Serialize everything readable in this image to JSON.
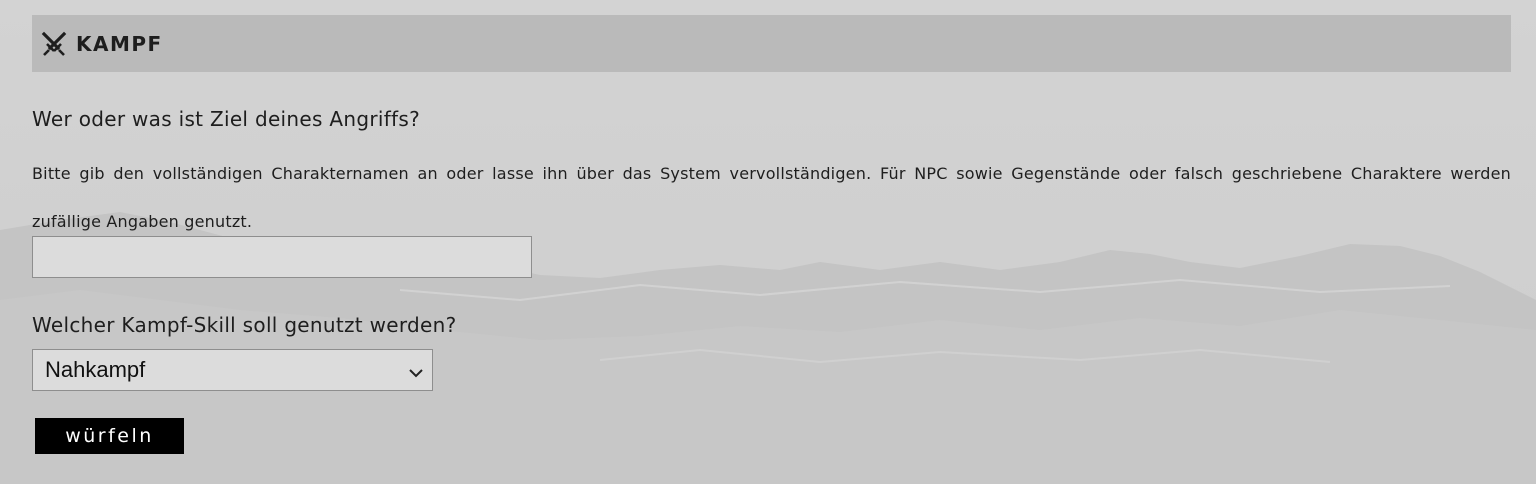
{
  "header": {
    "title": "KAMPF",
    "icon": "crossed-swords-icon"
  },
  "target_question": {
    "label": "Wer oder was ist Ziel deines Angriffs?",
    "hint": "Bitte gib den vollständigen Charakternamen an oder lasse ihn über das System vervollständigen. Für NPC sowie Gegenstände oder falsch geschriebene Charaktere werden zufällige Angaben genutzt.",
    "input_value": "",
    "input_placeholder": ""
  },
  "skill_question": {
    "label": "Welcher Kampf-Skill soll genutzt werden?",
    "selected": "Nahkampf",
    "icon": "chevron-down-icon"
  },
  "roll_button": {
    "label": "würfeln"
  },
  "colors": {
    "header_bg": "#bababa",
    "page_bg": "#cfcfcf",
    "field_bg": "#dcdcdc",
    "button_bg": "#000000",
    "button_text": "#ffffff",
    "text": "#1e1e1e"
  }
}
